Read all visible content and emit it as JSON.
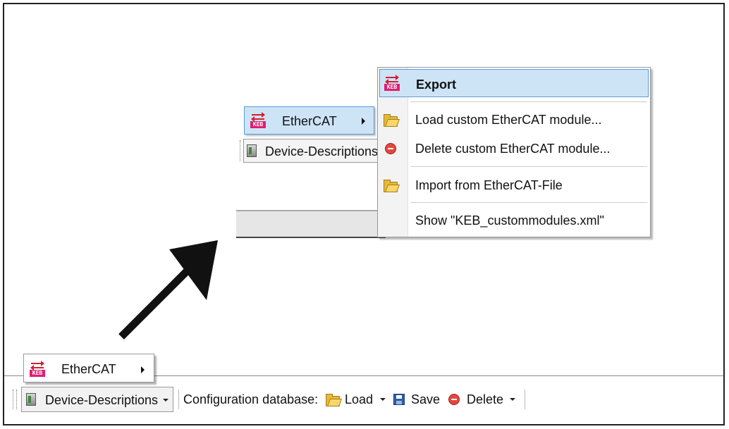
{
  "submenu": {
    "items": [
      {
        "label": "Export",
        "icon": "keb-icon"
      },
      {
        "label": "Load custom EtherCAT module...",
        "icon": "folder-open-icon"
      },
      {
        "label": "Delete custom EtherCAT module...",
        "icon": "delete-icon"
      },
      {
        "label": "Import from EtherCAT-File",
        "icon": "folder-open-icon"
      },
      {
        "label": "Show \"KEB_custommodules.xml\""
      }
    ]
  },
  "zoomed": {
    "menu_item": "EtherCAT",
    "device_descriptions": "Device-Descriptions"
  },
  "bottom": {
    "menu_item": "EtherCAT",
    "device_descriptions": "Device-Descriptions",
    "config_label": "Configuration database:",
    "load": "Load",
    "save": "Save",
    "delete": "Delete"
  },
  "colors": {
    "highlight": "#cde4f7",
    "highlight_border": "#5a9bd8",
    "keb_red": "#d2202f",
    "keb_pink": "#e01e73"
  }
}
